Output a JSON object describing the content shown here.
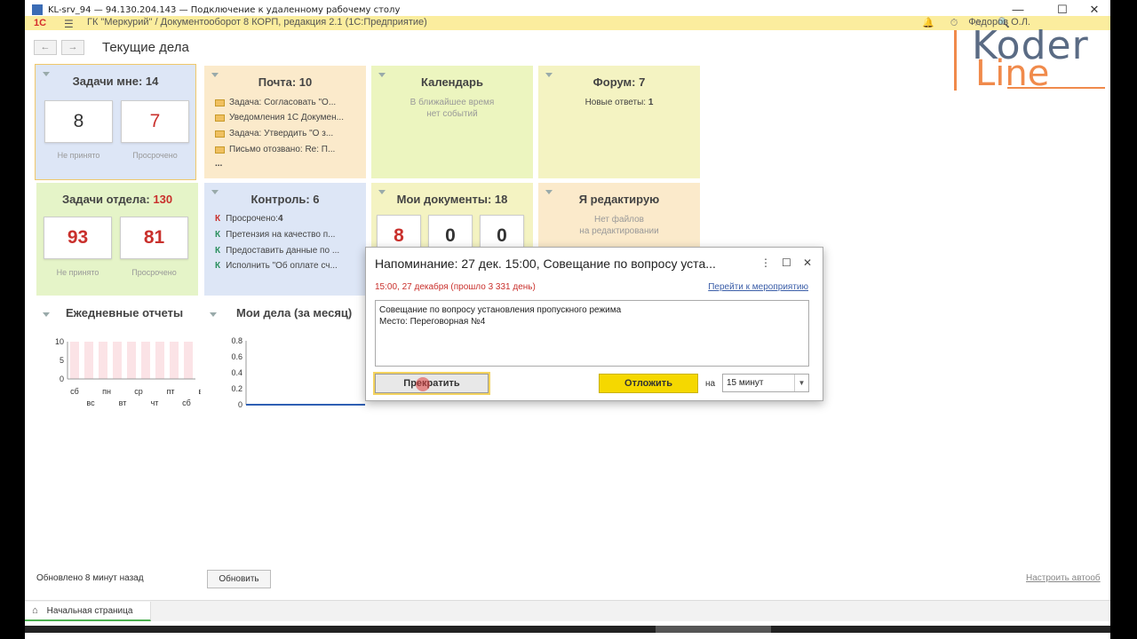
{
  "window": {
    "rdp_title": "KL-srv_94 — 94.130.204.143 — Подключение к удаленному рабочему столу",
    "controls": [
      "—",
      "☐",
      "✕"
    ]
  },
  "app": {
    "title": "ГК \"Меркурий\" / Документооборот 8 КОРП, редакция 2.1 (1С:Предприятие)",
    "user": "Федоров О.Л."
  },
  "page": {
    "title": "Текущие дела",
    "back_icon": "arrow-left-icon",
    "forward_icon": "arrow-right-icon"
  },
  "tiles": {
    "my_tasks": {
      "title": "Задачи мне: 14",
      "not_accepted_value": "8",
      "not_accepted_label": "Не принято",
      "overdue_value": "7",
      "overdue_label": "Просрочено"
    },
    "mail": {
      "title": "Почта: 10",
      "items": [
        "Задача: Согласовать \"О...",
        "Уведомления 1С Докумен...",
        "Задача: Утвердить \"О з...",
        "Письмо отозвано: Re: П..."
      ],
      "more": "..."
    },
    "calendar": {
      "title": "Календарь",
      "line1": "В ближайшее время",
      "line2": "нет событий"
    },
    "forum": {
      "title": "Форум: 7",
      "new_answers_label": "Новые ответы: ",
      "new_answers_value": "1"
    },
    "dept_tasks": {
      "title_prefix": "Задачи отдела: ",
      "title_value": "130",
      "not_accepted_value": "93",
      "not_accepted_label": "Не принято",
      "overdue_value": "81",
      "overdue_label": "Просрочено"
    },
    "control": {
      "title": "Контроль: 6",
      "items": [
        {
          "mark": "К",
          "text": "Просрочено: ",
          "bold": "4"
        },
        {
          "mark": "К",
          "text": "Претензия на качество п...",
          "bold": ""
        },
        {
          "mark": "К",
          "text": "Предоставить данные по ...",
          "bold": ""
        },
        {
          "mark": "К",
          "text": "Исполнить \"Об оплате сч...",
          "bold": ""
        }
      ]
    },
    "my_docs": {
      "title": "Мои документы: 18",
      "values": [
        "8",
        "0",
        "0"
      ]
    },
    "editing": {
      "title": "Я редактирую",
      "line1": "Нет файлов",
      "line2": "на редактировании"
    }
  },
  "daily_reports": {
    "title": "Ежедневные отчеты",
    "y_ticks": [
      "10",
      "5",
      "0"
    ],
    "x_top": [
      "сб",
      "пн",
      "ср",
      "пт",
      "вс"
    ],
    "x_bottom": [
      "вс",
      "вт",
      "чт",
      "сб"
    ]
  },
  "my_affairs": {
    "title": "Мои дела (за месяц)",
    "y_ticks": [
      "0.8",
      "0.6",
      "0.4",
      "0.2",
      "0"
    ]
  },
  "chart_data": [
    {
      "type": "bar",
      "title": "Ежедневные отчеты",
      "ylim": [
        0,
        10
      ],
      "categories": [
        "сб",
        "вс",
        "пн",
        "вт",
        "ср",
        "чт",
        "пт",
        "сб",
        "вс"
      ],
      "values": [
        0,
        0,
        0,
        0,
        0,
        0,
        0,
        0,
        0
      ]
    },
    {
      "type": "line",
      "title": "Мои дела (за месяц)",
      "ylim": [
        0,
        0.8
      ],
      "values": []
    }
  ],
  "reminder": {
    "title": "Напоминание: 27 дек. 15:00, Совещание по вопросу уста...",
    "date_line": "15:00, 27 декабря (прошло 3 331 день)",
    "goto_link": "Перейти к мероприятию",
    "text_line1": "Совещание по вопросу установления пропускного режима",
    "text_line2": "Место: Переговорная №4",
    "stop_button": "Прекратить",
    "delay_button": "Отложить",
    "on_label": "на",
    "delay_value": "15 минут"
  },
  "footer": {
    "updated": "Обновлено 8 минут назад",
    "refresh_button": "Обновить",
    "auto_link": "Настроить автооб"
  },
  "tabs": {
    "home": "Начальная страница"
  },
  "watermark": {
    "line1": "Koder",
    "line2": "Line"
  },
  "colors": {
    "tile_blue": "#dde6f6",
    "tile_orange": "#fbeacb",
    "tile_yellow": "#f4f3c2",
    "tile_lime": "#ecf5bf",
    "tile_green": "#e5f4c8",
    "accent_red": "#c9302c",
    "button_yellow": "#f5d800"
  }
}
